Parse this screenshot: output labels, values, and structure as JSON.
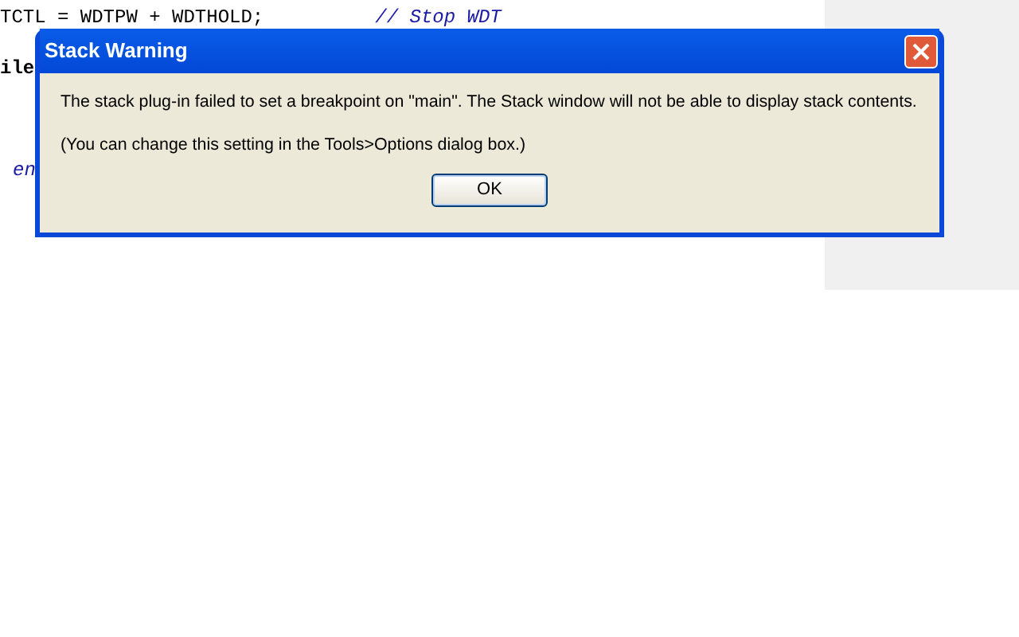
{
  "editor": {
    "lines": [
      {
        "kind": "plain",
        "code": "TCTL = WDTPW + WDTHOLD;",
        "comment": "// Stop WDT"
      },
      {
        "kind": "bold",
        "code": "ile"
      },
      {
        "kind": "keyword",
        "code": "en"
      }
    ]
  },
  "dialog": {
    "title": "Stack Warning",
    "messages": [
      "The stack plug-in failed to set a breakpoint on \"main\". The Stack window will not be able to display stack contents.",
      "(You can change this setting in the Tools>Options dialog box.)"
    ],
    "button": "OK"
  }
}
